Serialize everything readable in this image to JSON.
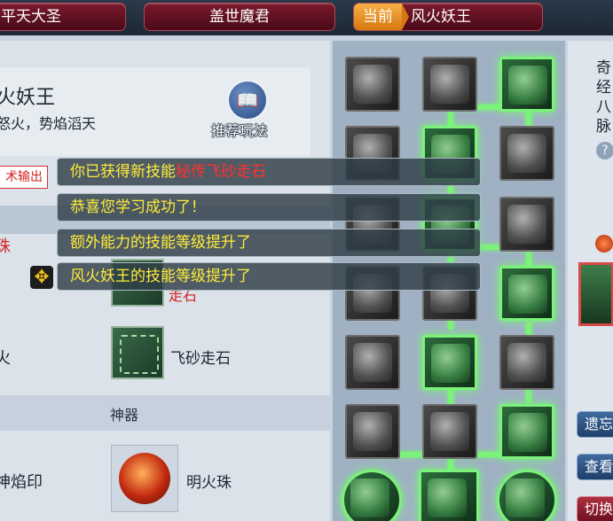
{
  "tabs": [
    {
      "label": "平天大圣"
    },
    {
      "label": "盖世魔君"
    },
    {
      "badge": "当前",
      "label": "风火妖王"
    }
  ],
  "hero": {
    "name": "火妖王",
    "subtitle": "怒火，势焰滔天",
    "recommend_label": "推荐玩法",
    "tag": "术输出"
  },
  "left_panel": {
    "pearl_text": "珠",
    "fire_label": "火",
    "stone_label": "走石",
    "feisha_label": "飞砂走石",
    "artifact_section": "神器",
    "seal_label": "神焰印",
    "artifact_label": "明火珠"
  },
  "notifications": [
    {
      "prefix": "你已获得新技能",
      "highlight": "秘传飞砂走石"
    },
    {
      "prefix": "恭喜您学习成功了！",
      "highlight": ""
    },
    {
      "prefix": "额外能力的技能等级提升了",
      "highlight": ""
    },
    {
      "prefix": "风火妖王的技能等级提升了",
      "highlight": ""
    }
  ],
  "right_strip": {
    "vertical_text": [
      "奇",
      "经",
      "八",
      "脉"
    ],
    "help": "?",
    "buttons": [
      "遗忘",
      "查看",
      "切换"
    ]
  },
  "colors": {
    "accent_green": "#7cf27a",
    "tab_red": "#7a1a2c",
    "current_badge": "#f7b047",
    "notice_yellow": "#ffec3a",
    "notice_red": "#ff3030"
  }
}
